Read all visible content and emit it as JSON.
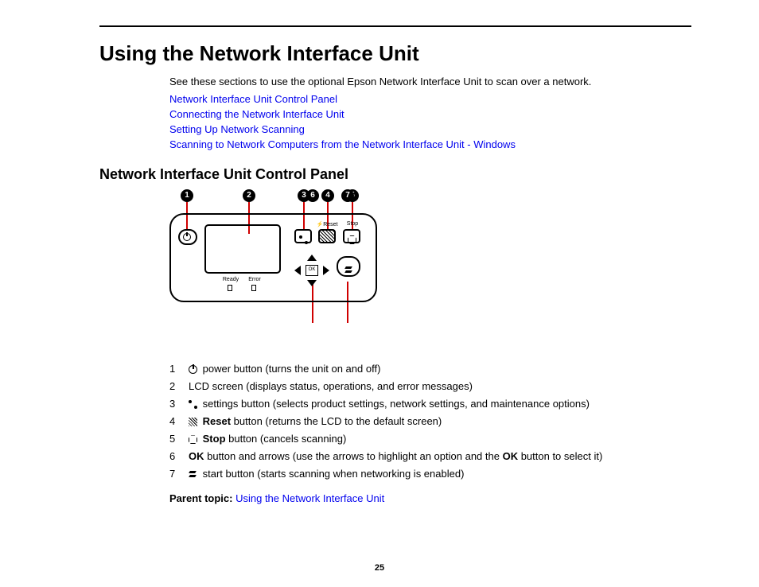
{
  "page_number": "25",
  "title": "Using the Network Interface Unit",
  "intro": "See these sections to use the optional Epson Network Interface Unit to scan over a network.",
  "links": [
    "Network Interface Unit Control Panel",
    "Connecting the Network Interface Unit",
    "Setting Up Network Scanning",
    "Scanning to Network Computers from the Network Interface Unit - Windows"
  ],
  "section_title": "Network Interface Unit Control Panel",
  "callouts": [
    "1",
    "2",
    "3",
    "4",
    "5",
    "6",
    "7"
  ],
  "panel_labels": {
    "reset": "Reset",
    "stop": "Stop",
    "ready": "Ready",
    "error": "Error",
    "ok": "OK"
  },
  "legend": [
    {
      "n": "1",
      "icon": "power",
      "text": " power button (turns the unit on and off)"
    },
    {
      "n": "2",
      "icon": "",
      "text": "LCD screen (displays status, operations, and error messages)"
    },
    {
      "n": "3",
      "icon": "settings",
      "text": " settings button (selects product settings, network settings, and maintenance options)"
    },
    {
      "n": "4",
      "icon": "reset",
      "bold": "Reset",
      "text": " button (returns the LCD to the default screen)"
    },
    {
      "n": "5",
      "icon": "stop",
      "bold": "Stop",
      "text": " button (cancels scanning)"
    },
    {
      "n": "6",
      "icon": "",
      "bold": "OK",
      "text": " button and arrows (use the arrows to highlight an option and the ",
      "bold2": "OK",
      "text2": " button to select it)"
    },
    {
      "n": "7",
      "icon": "start",
      "text": " start button (starts scanning when networking is enabled)"
    }
  ],
  "parent_label": "Parent topic:",
  "parent_link": "Using the Network Interface Unit"
}
